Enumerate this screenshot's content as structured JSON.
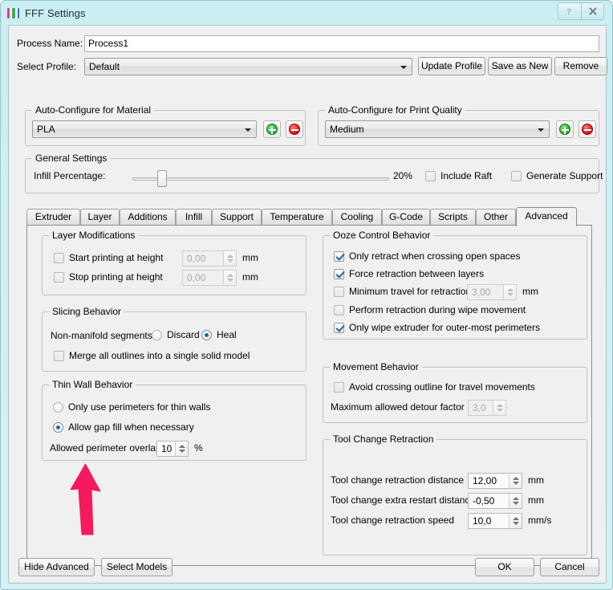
{
  "window": {
    "title": "FFF Settings",
    "app_icon": "filament-bars-icon",
    "caption_buttons": [
      {
        "name": "help-button",
        "glyph": "?"
      },
      {
        "name": "close-button",
        "glyph": "✕"
      }
    ]
  },
  "form": {
    "process_name_label": "Process Name:",
    "process_name_value": "Process1",
    "select_profile_label": "Select Profile:",
    "select_profile_value": "Default",
    "update_profile_label": "Update Profile",
    "save_as_new_label": "Save as New",
    "remove_label": "Remove"
  },
  "material": {
    "group_title": "Auto-Configure for Material",
    "value": "PLA",
    "add_label": "add-material",
    "remove_label": "remove-material"
  },
  "quality": {
    "group_title": "Auto-Configure for Print Quality",
    "value": "Medium",
    "add_label": "add-quality",
    "remove_label": "remove-quality"
  },
  "general": {
    "group_title": "General Settings",
    "infill_label": "Infill Percentage:",
    "infill_value": "20%",
    "infill_percent": 20,
    "include_raft_label": "Include Raft",
    "include_raft_checked": false,
    "generate_support_label": "Generate Support",
    "generate_support_checked": false
  },
  "tabs": {
    "items": [
      {
        "label": "Extruder",
        "active": false
      },
      {
        "label": "Layer",
        "active": false
      },
      {
        "label": "Additions",
        "active": false
      },
      {
        "label": "Infill",
        "active": false
      },
      {
        "label": "Support",
        "active": false
      },
      {
        "label": "Temperature",
        "active": false
      },
      {
        "label": "Cooling",
        "active": false
      },
      {
        "label": "G-Code",
        "active": false
      },
      {
        "label": "Scripts",
        "active": false
      },
      {
        "label": "Other",
        "active": false
      },
      {
        "label": "Advanced",
        "active": true
      }
    ],
    "active": "Advanced"
  },
  "layer_modifications": {
    "group_title": "Layer Modifications",
    "start_label": "Start printing at height",
    "start_checked": false,
    "start_value": "0,00",
    "start_unit": "mm",
    "stop_label": "Stop printing at height",
    "stop_checked": false,
    "stop_value": "0,00",
    "stop_unit": "mm"
  },
  "slicing_behavior": {
    "group_title": "Slicing Behavior",
    "nonmanifold_label": "Non-manifold segments:",
    "discard_label": "Discard",
    "discard_selected": false,
    "heal_label": "Heal",
    "heal_selected": true,
    "merge_label": "Merge all outlines into a single solid model",
    "merge_checked": false
  },
  "thin_wall_behavior": {
    "group_title": "Thin Wall Behavior",
    "perimeters_only_label": "Only use perimeters for thin walls",
    "perimeters_only_selected": false,
    "gap_fill_label": "Allow gap fill when necessary",
    "gap_fill_selected": true,
    "overlap_label": "Allowed perimeter overlap",
    "overlap_value": "10",
    "overlap_unit": "%"
  },
  "ooze_control": {
    "group_title": "Ooze Control Behavior",
    "only_retract_label": "Only retract when crossing open spaces",
    "only_retract_checked": true,
    "force_retraction_label": "Force retraction between layers",
    "force_retraction_checked": true,
    "min_travel_label": "Minimum travel for retraction",
    "min_travel_checked": false,
    "min_travel_value": "3,00",
    "min_travel_unit": "mm",
    "wipe_movement_label": "Perform retraction during wipe movement",
    "wipe_movement_checked": false,
    "only_wipe_label": "Only wipe extruder for outer-most perimeters",
    "only_wipe_checked": true
  },
  "movement_behavior": {
    "group_title": "Movement Behavior",
    "avoid_crossing_label": "Avoid crossing outline for travel movements",
    "avoid_crossing_checked": false,
    "detour_label": "Maximum allowed detour factor",
    "detour_value": "3,0"
  },
  "tool_change_retraction": {
    "group_title": "Tool Change Retraction",
    "distance_label": "Tool change retraction distance",
    "distance_value": "12,00",
    "distance_unit": "mm",
    "extra_restart_label": "Tool change extra restart distance",
    "extra_restart_value": "-0,50",
    "extra_restart_unit": "mm",
    "speed_label": "Tool change retraction speed",
    "speed_value": "10,0",
    "speed_unit": "mm/s"
  },
  "footer": {
    "hide_advanced_label": "Hide Advanced",
    "select_models_label": "Select Models",
    "ok_label": "OK",
    "cancel_label": "Cancel"
  },
  "annotation": {
    "arrow_color": "#f5195e",
    "arrow_direction": "up",
    "points_at": "Allowed perimeter overlap"
  }
}
